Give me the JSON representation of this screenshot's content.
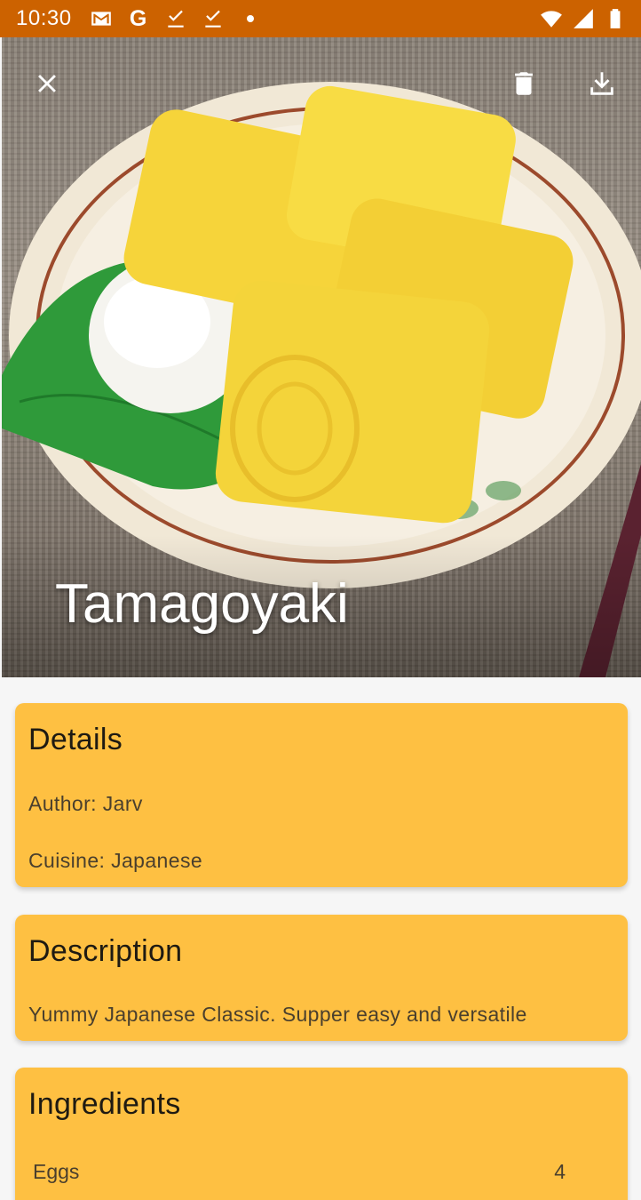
{
  "status_bar": {
    "time": "10:30",
    "left_icons": [
      "gmail-icon",
      "google-icon",
      "download-done-icon",
      "download-done-icon",
      "notification-dot-icon"
    ],
    "right_icons": [
      "wifi-icon",
      "signal-icon",
      "battery-icon"
    ],
    "google_glyph": "G",
    "background": "#cc6200"
  },
  "hero": {
    "title": "Tamagoyaki",
    "close_icon": "close-icon",
    "delete_icon": "trash-icon",
    "download_icon": "download-icon"
  },
  "details": {
    "heading": "Details",
    "author": "Author: Jarv",
    "cuisine": "Cuisine: Japanese"
  },
  "description": {
    "heading": "Description",
    "text": "Yummy Japanese Classic. Supper easy and versatile"
  },
  "ingredients": {
    "heading": "Ingredients",
    "items": [
      {
        "name": "Eggs",
        "quantity": "4"
      }
    ]
  },
  "colors": {
    "card": "#fec042",
    "background": "#f6f6f6",
    "status_bar": "#cc6200"
  }
}
